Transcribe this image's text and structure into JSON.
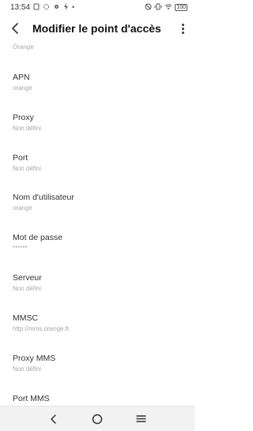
{
  "status_bar": {
    "time": "13:54",
    "battery": "100",
    "left_icons": [
      "notification-icon",
      "settings-icon",
      "gear-icon",
      "charge-icon"
    ],
    "right_icons": [
      "mute-icon",
      "vibrate-icon",
      "wifi-icon",
      "battery-icon"
    ]
  },
  "app_bar": {
    "title": "Modifier le point d'accès"
  },
  "partial_top": {
    "value": "Orange"
  },
  "fields": [
    {
      "label": "APN",
      "value": "orange"
    },
    {
      "label": "Proxy",
      "value": "Non défini"
    },
    {
      "label": "Port",
      "value": "Non défini"
    },
    {
      "label": "Nom d'utilisateur",
      "value": "orange"
    },
    {
      "label": "Mot de passe",
      "value": "******"
    },
    {
      "label": "Serveur",
      "value": "Non défini"
    },
    {
      "label": "MMSC",
      "value": "http://mms.orange.fr"
    },
    {
      "label": "Proxy MMS",
      "value": "Non défini"
    },
    {
      "label": "Port MMS",
      "value": ""
    }
  ],
  "nav": {
    "icons": [
      "back-nav-icon",
      "home-nav-icon",
      "recents-nav-icon"
    ]
  }
}
